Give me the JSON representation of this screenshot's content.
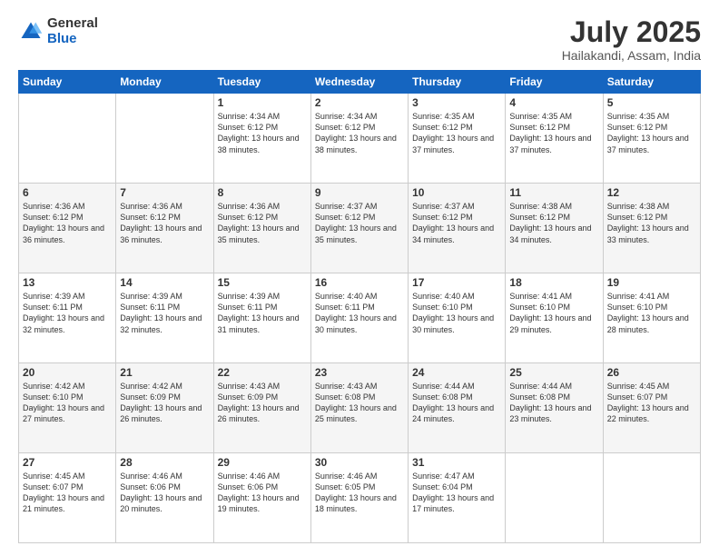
{
  "logo": {
    "general": "General",
    "blue": "Blue"
  },
  "header": {
    "month": "July 2025",
    "location": "Hailakandi, Assam, India"
  },
  "weekdays": [
    "Sunday",
    "Monday",
    "Tuesday",
    "Wednesday",
    "Thursday",
    "Friday",
    "Saturday"
  ],
  "weeks": [
    [
      {
        "day": "",
        "info": ""
      },
      {
        "day": "",
        "info": ""
      },
      {
        "day": "1",
        "info": "Sunrise: 4:34 AM\nSunset: 6:12 PM\nDaylight: 13 hours and 38 minutes."
      },
      {
        "day": "2",
        "info": "Sunrise: 4:34 AM\nSunset: 6:12 PM\nDaylight: 13 hours and 38 minutes."
      },
      {
        "day": "3",
        "info": "Sunrise: 4:35 AM\nSunset: 6:12 PM\nDaylight: 13 hours and 37 minutes."
      },
      {
        "day": "4",
        "info": "Sunrise: 4:35 AM\nSunset: 6:12 PM\nDaylight: 13 hours and 37 minutes."
      },
      {
        "day": "5",
        "info": "Sunrise: 4:35 AM\nSunset: 6:12 PM\nDaylight: 13 hours and 37 minutes."
      }
    ],
    [
      {
        "day": "6",
        "info": "Sunrise: 4:36 AM\nSunset: 6:12 PM\nDaylight: 13 hours and 36 minutes."
      },
      {
        "day": "7",
        "info": "Sunrise: 4:36 AM\nSunset: 6:12 PM\nDaylight: 13 hours and 36 minutes."
      },
      {
        "day": "8",
        "info": "Sunrise: 4:36 AM\nSunset: 6:12 PM\nDaylight: 13 hours and 35 minutes."
      },
      {
        "day": "9",
        "info": "Sunrise: 4:37 AM\nSunset: 6:12 PM\nDaylight: 13 hours and 35 minutes."
      },
      {
        "day": "10",
        "info": "Sunrise: 4:37 AM\nSunset: 6:12 PM\nDaylight: 13 hours and 34 minutes."
      },
      {
        "day": "11",
        "info": "Sunrise: 4:38 AM\nSunset: 6:12 PM\nDaylight: 13 hours and 34 minutes."
      },
      {
        "day": "12",
        "info": "Sunrise: 4:38 AM\nSunset: 6:12 PM\nDaylight: 13 hours and 33 minutes."
      }
    ],
    [
      {
        "day": "13",
        "info": "Sunrise: 4:39 AM\nSunset: 6:11 PM\nDaylight: 13 hours and 32 minutes."
      },
      {
        "day": "14",
        "info": "Sunrise: 4:39 AM\nSunset: 6:11 PM\nDaylight: 13 hours and 32 minutes."
      },
      {
        "day": "15",
        "info": "Sunrise: 4:39 AM\nSunset: 6:11 PM\nDaylight: 13 hours and 31 minutes."
      },
      {
        "day": "16",
        "info": "Sunrise: 4:40 AM\nSunset: 6:11 PM\nDaylight: 13 hours and 30 minutes."
      },
      {
        "day": "17",
        "info": "Sunrise: 4:40 AM\nSunset: 6:10 PM\nDaylight: 13 hours and 30 minutes."
      },
      {
        "day": "18",
        "info": "Sunrise: 4:41 AM\nSunset: 6:10 PM\nDaylight: 13 hours and 29 minutes."
      },
      {
        "day": "19",
        "info": "Sunrise: 4:41 AM\nSunset: 6:10 PM\nDaylight: 13 hours and 28 minutes."
      }
    ],
    [
      {
        "day": "20",
        "info": "Sunrise: 4:42 AM\nSunset: 6:10 PM\nDaylight: 13 hours and 27 minutes."
      },
      {
        "day": "21",
        "info": "Sunrise: 4:42 AM\nSunset: 6:09 PM\nDaylight: 13 hours and 26 minutes."
      },
      {
        "day": "22",
        "info": "Sunrise: 4:43 AM\nSunset: 6:09 PM\nDaylight: 13 hours and 26 minutes."
      },
      {
        "day": "23",
        "info": "Sunrise: 4:43 AM\nSunset: 6:08 PM\nDaylight: 13 hours and 25 minutes."
      },
      {
        "day": "24",
        "info": "Sunrise: 4:44 AM\nSunset: 6:08 PM\nDaylight: 13 hours and 24 minutes."
      },
      {
        "day": "25",
        "info": "Sunrise: 4:44 AM\nSunset: 6:08 PM\nDaylight: 13 hours and 23 minutes."
      },
      {
        "day": "26",
        "info": "Sunrise: 4:45 AM\nSunset: 6:07 PM\nDaylight: 13 hours and 22 minutes."
      }
    ],
    [
      {
        "day": "27",
        "info": "Sunrise: 4:45 AM\nSunset: 6:07 PM\nDaylight: 13 hours and 21 minutes."
      },
      {
        "day": "28",
        "info": "Sunrise: 4:46 AM\nSunset: 6:06 PM\nDaylight: 13 hours and 20 minutes."
      },
      {
        "day": "29",
        "info": "Sunrise: 4:46 AM\nSunset: 6:06 PM\nDaylight: 13 hours and 19 minutes."
      },
      {
        "day": "30",
        "info": "Sunrise: 4:46 AM\nSunset: 6:05 PM\nDaylight: 13 hours and 18 minutes."
      },
      {
        "day": "31",
        "info": "Sunrise: 4:47 AM\nSunset: 6:04 PM\nDaylight: 13 hours and 17 minutes."
      },
      {
        "day": "",
        "info": ""
      },
      {
        "day": "",
        "info": ""
      }
    ]
  ]
}
